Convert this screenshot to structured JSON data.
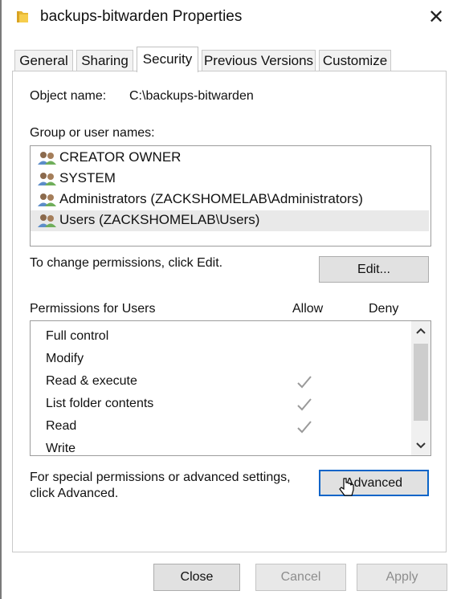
{
  "window": {
    "title": "backups-bitwarden Properties",
    "close_glyph": "✕",
    "folder_icon": "folder-icon"
  },
  "tabs": [
    {
      "label": "General",
      "active": false
    },
    {
      "label": "Sharing",
      "active": false
    },
    {
      "label": "Security",
      "active": true
    },
    {
      "label": "Previous Versions",
      "active": false
    },
    {
      "label": "Customize",
      "active": false
    }
  ],
  "security": {
    "object_name_label": "Object name:",
    "object_name_value": "C:\\backups-bitwarden",
    "group_label": "Group or user names:",
    "groups": [
      {
        "name": "CREATOR OWNER",
        "selected": false
      },
      {
        "name": "SYSTEM",
        "selected": false
      },
      {
        "name": "Administrators (ZACKSHOMELAB\\Administrators)",
        "selected": false
      },
      {
        "name": "Users (ZACKSHOMELAB\\Users)",
        "selected": true
      }
    ],
    "change_hint": "To change permissions, click Edit.",
    "edit_button": "Edit...",
    "permissions_label": "Permissions for Users",
    "allow_header": "Allow",
    "deny_header": "Deny",
    "permissions": [
      {
        "name": "Full control",
        "allow": false,
        "deny": false
      },
      {
        "name": "Modify",
        "allow": false,
        "deny": false
      },
      {
        "name": "Read & execute",
        "allow": true,
        "deny": false
      },
      {
        "name": "List folder contents",
        "allow": true,
        "deny": false
      },
      {
        "name": "Read",
        "allow": true,
        "deny": false
      },
      {
        "name": "Write",
        "allow": false,
        "deny": false
      }
    ],
    "special_hint_line1": "For special permissions or advanced settings,",
    "special_hint_line2": "click Advanced.",
    "advanced_button": "Advanced"
  },
  "footer": {
    "close_button": "Close",
    "cancel_button": "Cancel",
    "apply_button": "Apply"
  },
  "colors": {
    "focus_border": "#0a64c8",
    "selected_row": "#e9e9e9",
    "check_mark": "#9a9a9a"
  }
}
